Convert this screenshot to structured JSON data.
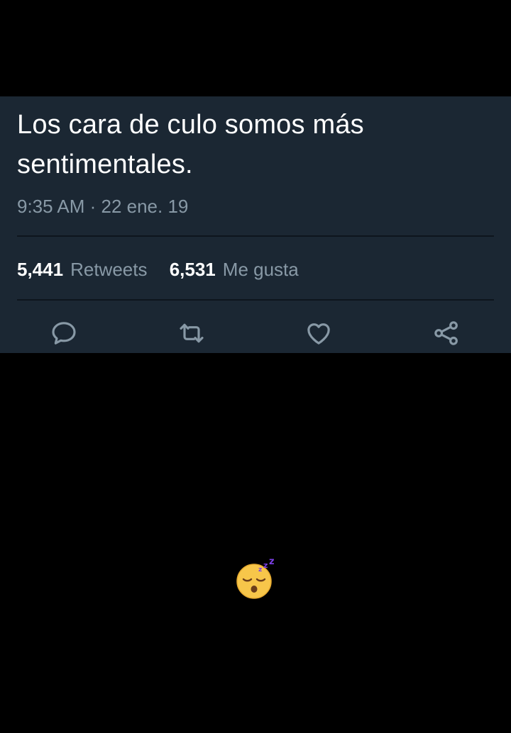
{
  "tweet": {
    "text": "Los cara de culo somos más sentimentales.",
    "timestamp": "9:35 AM · 22 ene. 19"
  },
  "stats": {
    "retweets_count": "5,441",
    "retweets_label": "Retweets",
    "likes_count": "6,531",
    "likes_label": "Me gusta"
  },
  "actions": {
    "reply_icon": "reply-icon",
    "retweet_icon": "retweet-icon",
    "like_icon": "heart-icon",
    "share_icon": "share-icon"
  },
  "overlay": {
    "emoji_icon": "sleeping-face-icon"
  },
  "colors": {
    "background": "#000000",
    "card": "#1b2733",
    "primary_text": "#ffffff",
    "secondary_text": "#8899a6",
    "icon": "#8899a6"
  }
}
